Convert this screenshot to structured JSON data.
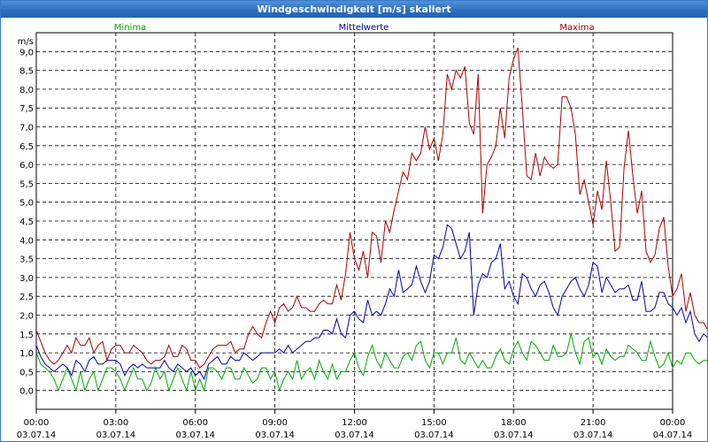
{
  "window": {
    "title": "Windgeschwindigkeit [m/s] skaliert"
  },
  "colors": {
    "minima": "#00aa00",
    "mittel": "#0000aa",
    "maxima": "#aa0000",
    "titlebar": "#2c6fbf"
  },
  "chart_data": {
    "type": "line",
    "title": "Windgeschwindigkeit [m/s] skaliert",
    "ylabel": "m/s",
    "xlabel": "",
    "ylim": [
      -0.5,
      9.5
    ],
    "yticks": [
      "0,0",
      "0,5",
      "1,0",
      "1,5",
      "2,0",
      "2,5",
      "3,0",
      "3,5",
      "4,0",
      "4,5",
      "5,0",
      "5,5",
      "6,0",
      "6,5",
      "7,0",
      "7,5",
      "8,0",
      "8,5",
      "9,0"
    ],
    "xlim": [
      0,
      24
    ],
    "xticks": [
      {
        "time": "00:00",
        "date": "03.07.14"
      },
      {
        "time": "03:00",
        "date": "03.07.14"
      },
      {
        "time": "06:00",
        "date": "03.07.14"
      },
      {
        "time": "09:00",
        "date": "03.07.14"
      },
      {
        "time": "12:00",
        "date": "03.07.14"
      },
      {
        "time": "15:00",
        "date": "03.07.14"
      },
      {
        "time": "18:00",
        "date": "03.07.14"
      },
      {
        "time": "21:00",
        "date": "03.07.14"
      },
      {
        "time": "00:00",
        "date": "04.07.14"
      }
    ],
    "grid": true,
    "legend_position": "top",
    "x_unit": "hours since 03.07.14 00:00, step 0.1667",
    "series": [
      {
        "name": "Minima",
        "color": "#00aa00",
        "values": [
          1.0,
          0.7,
          0.6,
          0.5,
          0.3,
          0.0,
          0.3,
          0.6,
          0.3,
          0.0,
          0.5,
          0.0,
          0.3,
          0.5,
          0.0,
          0.3,
          0.6,
          0.6,
          0.5,
          0.3,
          0.0,
          0.3,
          0.6,
          0.3,
          0.3,
          0.0,
          0.2,
          0.6,
          0.3,
          0.5,
          0.0,
          0.3,
          0.6,
          0.3,
          0.0,
          0.5,
          0.0,
          0.3,
          0.0,
          0.6,
          0.6,
          0.5,
          0.3,
          0.6,
          0.6,
          0.3,
          0.3,
          0.6,
          0.4,
          0.2,
          0.3,
          0.6,
          0.6,
          0.3,
          0.5,
          0.0,
          0.3,
          0.5,
          0.3,
          0.8,
          0.3,
          0.5,
          0.6,
          0.3,
          0.8,
          0.5,
          0.3,
          0.7,
          0.3,
          0.5,
          0.5,
          0.8,
          1.0,
          0.6,
          0.4,
          0.9,
          1.2,
          0.8,
          0.6,
          1.0,
          0.8,
          0.6,
          0.6,
          0.9,
          1.0,
          0.8,
          1.2,
          1.3,
          0.8,
          0.6,
          1.0,
          1.0,
          0.7,
          1.0,
          1.0,
          1.4,
          0.8,
          0.7,
          1.0,
          0.8,
          0.6,
          0.8,
          0.6,
          0.6,
          0.9,
          1.1,
          0.8,
          0.7,
          1.1,
          1.3,
          1.0,
          0.8,
          1.3,
          1.2,
          1.0,
          0.8,
          0.8,
          1.2,
          0.9,
          0.9,
          1.0,
          1.5,
          1.0,
          0.7,
          1.3,
          1.4,
          0.9,
          1.0,
          0.7,
          1.1,
          0.9,
          0.8,
          0.9,
          0.9,
          1.2,
          1.1,
          1.0,
          0.8,
          0.8,
          1.3,
          0.9,
          0.6,
          0.7,
          1.0,
          0.6,
          0.8,
          0.7,
          1.0,
          1.0,
          0.8,
          0.7,
          0.8,
          0.8,
          0.8,
          0.9,
          0.5,
          0.5,
          0.6,
          0.5,
          0.5,
          0.6,
          0.5,
          0.6,
          0.5,
          0.5,
          0.5,
          0.6,
          0.5,
          0.2,
          0.0,
          0.5,
          0.3,
          0.5,
          0.7,
          0.3,
          0.4,
          0.5,
          0.6,
          0.6,
          0.7,
          0.5,
          0.7
        ]
      },
      {
        "name": "Mittelwerte",
        "color": "#0000aa",
        "values": [
          1.2,
          0.9,
          0.7,
          0.6,
          0.5,
          0.6,
          0.7,
          0.6,
          0.4,
          0.8,
          0.7,
          0.5,
          0.8,
          0.9,
          0.7,
          0.7,
          0.8,
          0.8,
          0.8,
          0.7,
          0.4,
          0.6,
          0.7,
          0.6,
          0.7,
          0.6,
          0.6,
          0.6,
          0.6,
          0.8,
          0.6,
          0.5,
          0.7,
          0.6,
          0.5,
          0.6,
          0.4,
          0.5,
          0.3,
          0.7,
          0.8,
          0.9,
          0.7,
          0.7,
          0.9,
          0.8,
          0.8,
          1.0,
          0.9,
          0.8,
          0.9,
          1.0,
          1.0,
          1.0,
          1.0,
          1.1,
          1.0,
          1.2,
          1.0,
          1.1,
          1.2,
          1.3,
          1.3,
          1.4,
          1.4,
          1.6,
          1.6,
          1.5,
          1.9,
          1.5,
          1.4,
          2.0,
          2.1,
          1.9,
          1.8,
          2.4,
          2.0,
          2.1,
          2.0,
          2.3,
          2.7,
          2.5,
          3.2,
          2.6,
          2.7,
          2.8,
          3.3,
          2.9,
          2.6,
          2.9,
          3.6,
          3.5,
          3.8,
          4.4,
          4.3,
          3.9,
          3.5,
          3.7,
          4.2,
          2.0,
          2.8,
          3.1,
          3.0,
          3.4,
          3.5,
          3.9,
          2.7,
          2.9,
          2.5,
          2.3,
          3.1,
          3.0,
          2.7,
          2.5,
          2.8,
          2.9,
          2.6,
          2.2,
          2.0,
          2.5,
          2.7,
          2.9,
          3.0,
          2.7,
          2.5,
          2.8,
          3.4,
          3.3,
          2.6,
          3.0,
          2.8,
          2.6,
          2.7,
          2.7,
          2.8,
          2.4,
          2.4,
          2.9,
          2.1,
          2.1,
          2.2,
          2.6,
          2.6,
          2.3,
          2.2,
          2.0,
          2.2,
          1.8,
          2.1,
          1.5,
          1.3,
          1.5,
          1.4,
          1.6,
          1.4,
          1.3,
          1.4,
          1.2,
          1.1,
          1.1,
          1.3,
          1.1,
          1.0,
          1.1,
          1.0,
          0.9,
          0.8,
          1.0,
          1.0,
          0.7,
          0.8,
          0.8,
          0.6,
          0.6,
          0.6,
          0.7,
          0.7,
          0.8,
          0.9,
          0.8,
          0.8,
          0.9,
          0.9,
          0.8,
          0.9,
          1.0,
          1.0,
          0.9
        ]
      },
      {
        "name": "Maxima",
        "color": "#aa0000",
        "values": [
          1.6,
          1.3,
          1.0,
          0.8,
          0.7,
          0.8,
          1.0,
          1.2,
          1.0,
          1.4,
          1.2,
          1.2,
          1.4,
          1.0,
          1.2,
          1.3,
          0.8,
          1.1,
          1.2,
          1.2,
          1.0,
          1.0,
          1.2,
          1.1,
          1.0,
          0.8,
          0.7,
          0.8,
          0.8,
          0.9,
          1.2,
          0.9,
          0.9,
          1.2,
          1.1,
          0.8,
          0.8,
          0.6,
          0.7,
          0.9,
          1.1,
          1.2,
          1.2,
          1.2,
          1.3,
          1.0,
          1.1,
          1.1,
          1.5,
          1.7,
          1.5,
          1.4,
          1.8,
          2.1,
          1.8,
          2.2,
          2.3,
          2.1,
          2.2,
          2.5,
          2.2,
          2.2,
          2.1,
          2.1,
          2.3,
          2.4,
          2.3,
          2.3,
          2.8,
          2.4,
          3.1,
          4.2,
          3.5,
          3.2,
          3.7,
          3.0,
          4.2,
          4.1,
          3.4,
          4.5,
          4.2,
          4.8,
          5.3,
          5.8,
          5.6,
          6.3,
          6.1,
          6.3,
          7.0,
          6.4,
          6.7,
          6.1,
          6.8,
          8.4,
          8.0,
          8.5,
          8.3,
          8.6,
          7.1,
          6.8,
          8.4,
          4.7,
          6.0,
          6.2,
          6.5,
          7.5,
          6.7,
          8.3,
          8.8,
          9.1,
          7.5,
          5.7,
          5.6,
          6.3,
          5.7,
          6.2,
          6.0,
          5.9,
          6.0,
          7.8,
          7.8,
          7.5,
          6.8,
          5.2,
          5.6,
          5.0,
          4.4,
          5.3,
          4.8,
          6.1,
          5.0,
          3.7,
          3.8,
          5.9,
          6.9,
          5.7,
          4.7,
          5.3,
          3.7,
          3.4,
          3.6,
          4.3,
          4.6,
          3.3,
          2.5,
          2.7,
          3.1,
          2.1,
          2.6,
          2.0,
          1.8,
          1.8,
          1.6,
          1.7,
          2.1,
          2.2,
          1.8,
          1.9,
          2.0,
          1.8,
          1.8,
          1.6,
          1.3,
          1.5,
          1.2,
          1.0,
          1.0,
          1.1,
          1.1,
          1.0,
          0.9,
          1.0,
          1.1,
          1.0,
          1.0,
          1.2,
          1.0,
          1.0,
          1.1,
          1.1,
          1.2,
          1.3,
          1.2,
          1.1,
          1.2,
          1.1
        ]
      }
    ]
  }
}
